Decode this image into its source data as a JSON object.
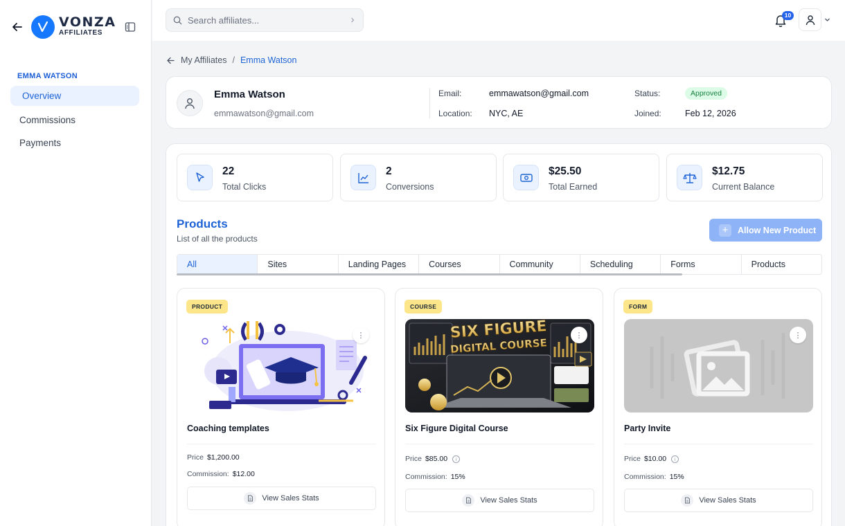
{
  "brand": {
    "name": "VONZA",
    "sub": "AFFILIATES",
    "accent": "#1677ff"
  },
  "sidebar": {
    "section": "EMMA WATSON",
    "items": [
      {
        "label": "Overview",
        "active": true
      },
      {
        "label": "Commissions",
        "active": false
      },
      {
        "label": "Payments",
        "active": false
      }
    ]
  },
  "topbar": {
    "search_placeholder": "Search affiliates...",
    "notifications": "10"
  },
  "breadcrumb": {
    "parent": "My Affiliates",
    "sep": "/",
    "current": "Emma Watson"
  },
  "profile": {
    "name": "Emma Watson",
    "email": "emmawatson@gmail.com",
    "email_label": "Email:",
    "email_value": "emmawatson@gmail.com",
    "location_label": "Location:",
    "location_value": "NYC, AE",
    "status_label": "Status:",
    "status_value": "Approved",
    "joined_label": "Joined:",
    "joined_value": "Feb 12, 2026"
  },
  "stats": [
    {
      "value": "22",
      "label": "Total Clicks",
      "icon": "cursor-icon"
    },
    {
      "value": "2",
      "label": "Conversions",
      "icon": "line-chart-icon"
    },
    {
      "value": "$25.50",
      "label": "Total Earned",
      "icon": "money-icon"
    },
    {
      "value": "$12.75",
      "label": "Current Balance",
      "icon": "scale-icon"
    }
  ],
  "products": {
    "title": "Products",
    "subtitle": "List of all the products",
    "allow_button": "Allow New Product",
    "tabs": [
      "All",
      "Sites",
      "Landing Pages",
      "Courses",
      "Community",
      "Scheduling",
      "Forms",
      "Products"
    ],
    "active_tab": "All",
    "cards": [
      {
        "tag": "PRODUCT",
        "name": "Coaching templates",
        "price_label": "Price",
        "price": "$1,200.00",
        "commission_label": "Commission:",
        "commission": "$12.00",
        "button": "View Sales Stats"
      },
      {
        "tag": "COURSE",
        "name": "Six Figure Digital Course",
        "price_label": "Price",
        "price": "$85.00",
        "commission_label": "Commission:",
        "commission": "15%",
        "button": "View Sales Stats",
        "thumb_text_1": "SIX FIGURE",
        "thumb_text_2": "DIGITAL COURSE"
      },
      {
        "tag": "FORM",
        "name": "Party Invite",
        "price_label": "Price",
        "price": "$10.00",
        "commission_label": "Commission:",
        "commission": "15%",
        "button": "View Sales Stats"
      }
    ]
  }
}
